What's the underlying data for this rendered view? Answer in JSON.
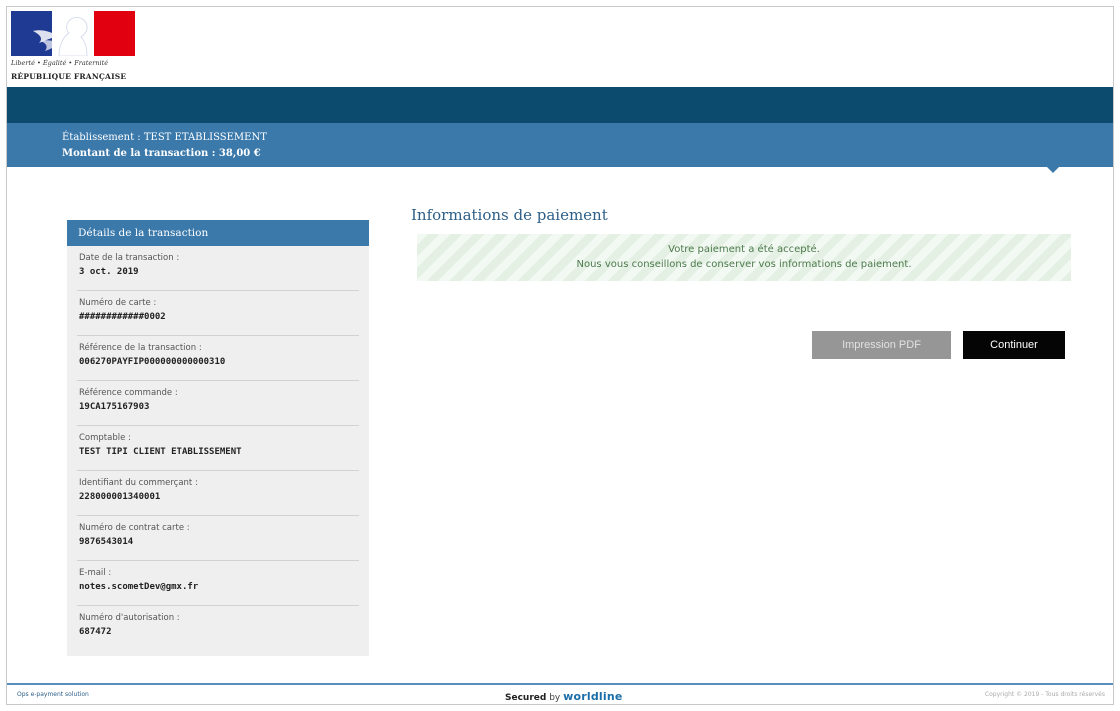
{
  "header": {
    "logo": {
      "motto": "Liberté • Égalité • Fraternité",
      "republic": "RÉPUBLIQUE FRANÇAISE"
    },
    "establishment_line": "Établissement : TEST ETABLISSEMENT",
    "amount_line": "Montant de la transaction :  38,00 €"
  },
  "sidebar": {
    "title": "Détails de la transaction",
    "items": [
      {
        "label": "Date de la transaction :",
        "value": "3 oct. 2019"
      },
      {
        "label": "Numéro de carte :",
        "value": "############0002"
      },
      {
        "label": "Référence de la transaction :",
        "value": "006270PAYFIP000000000000310"
      },
      {
        "label": "Référence commande :",
        "value": "19CA175167903"
      },
      {
        "label": "Comptable :",
        "value": "TEST TIPI CLIENT ETABLISSEMENT"
      },
      {
        "label": "Identifiant du commerçant :",
        "value": "228000001340001"
      },
      {
        "label": "Numéro de contrat carte :",
        "value": "9876543014"
      },
      {
        "label": "E-mail :",
        "value": "notes.scometDev@gmx.fr"
      },
      {
        "label": "Numéro d'autorisation :",
        "value": "687472"
      }
    ]
  },
  "main": {
    "title": "Informations de paiement",
    "alert_line1": "Votre paiement a été accepté.",
    "alert_line2": "Nous vous conseillons de conserver vos informations de paiement.",
    "pdf_button": "Impression PDF",
    "continue_button": "Continuer"
  },
  "footer": {
    "left": "Ops e-payment solution",
    "secured": "Secured",
    "by": "by",
    "brand": "worldline",
    "right": "Copyright © 2019 - Tous droits réservés"
  },
  "colors": {
    "top_bar": "#0c4a6e",
    "info_bar": "#3b79ab",
    "alert_bg": "#e3f0e3",
    "pdf_button": "#969696",
    "continue_button": "#050505"
  }
}
